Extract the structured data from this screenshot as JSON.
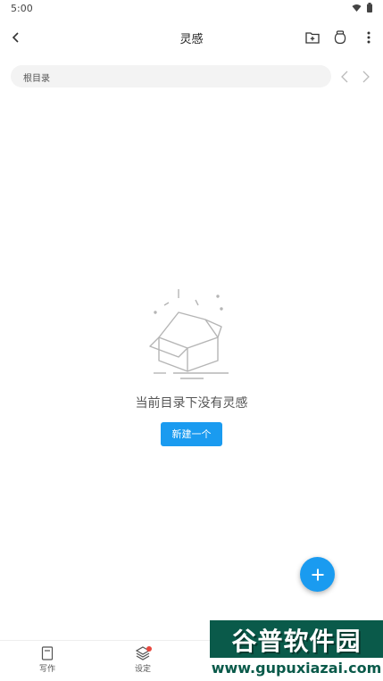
{
  "status_bar": {
    "time": "5:00"
  },
  "app_bar": {
    "title": "灵感"
  },
  "path": {
    "label": "根目录"
  },
  "empty": {
    "message": "当前目录下没有灵感",
    "create_label": "新建一个"
  },
  "bottom_nav": {
    "items": [
      {
        "label": "写作"
      },
      {
        "label": "设定"
      }
    ]
  },
  "watermark": {
    "title": "谷普软件园",
    "url": "www.gupuxiazai.com"
  },
  "colors": {
    "accent": "#1a9bf0",
    "badge": "#e8473e"
  }
}
